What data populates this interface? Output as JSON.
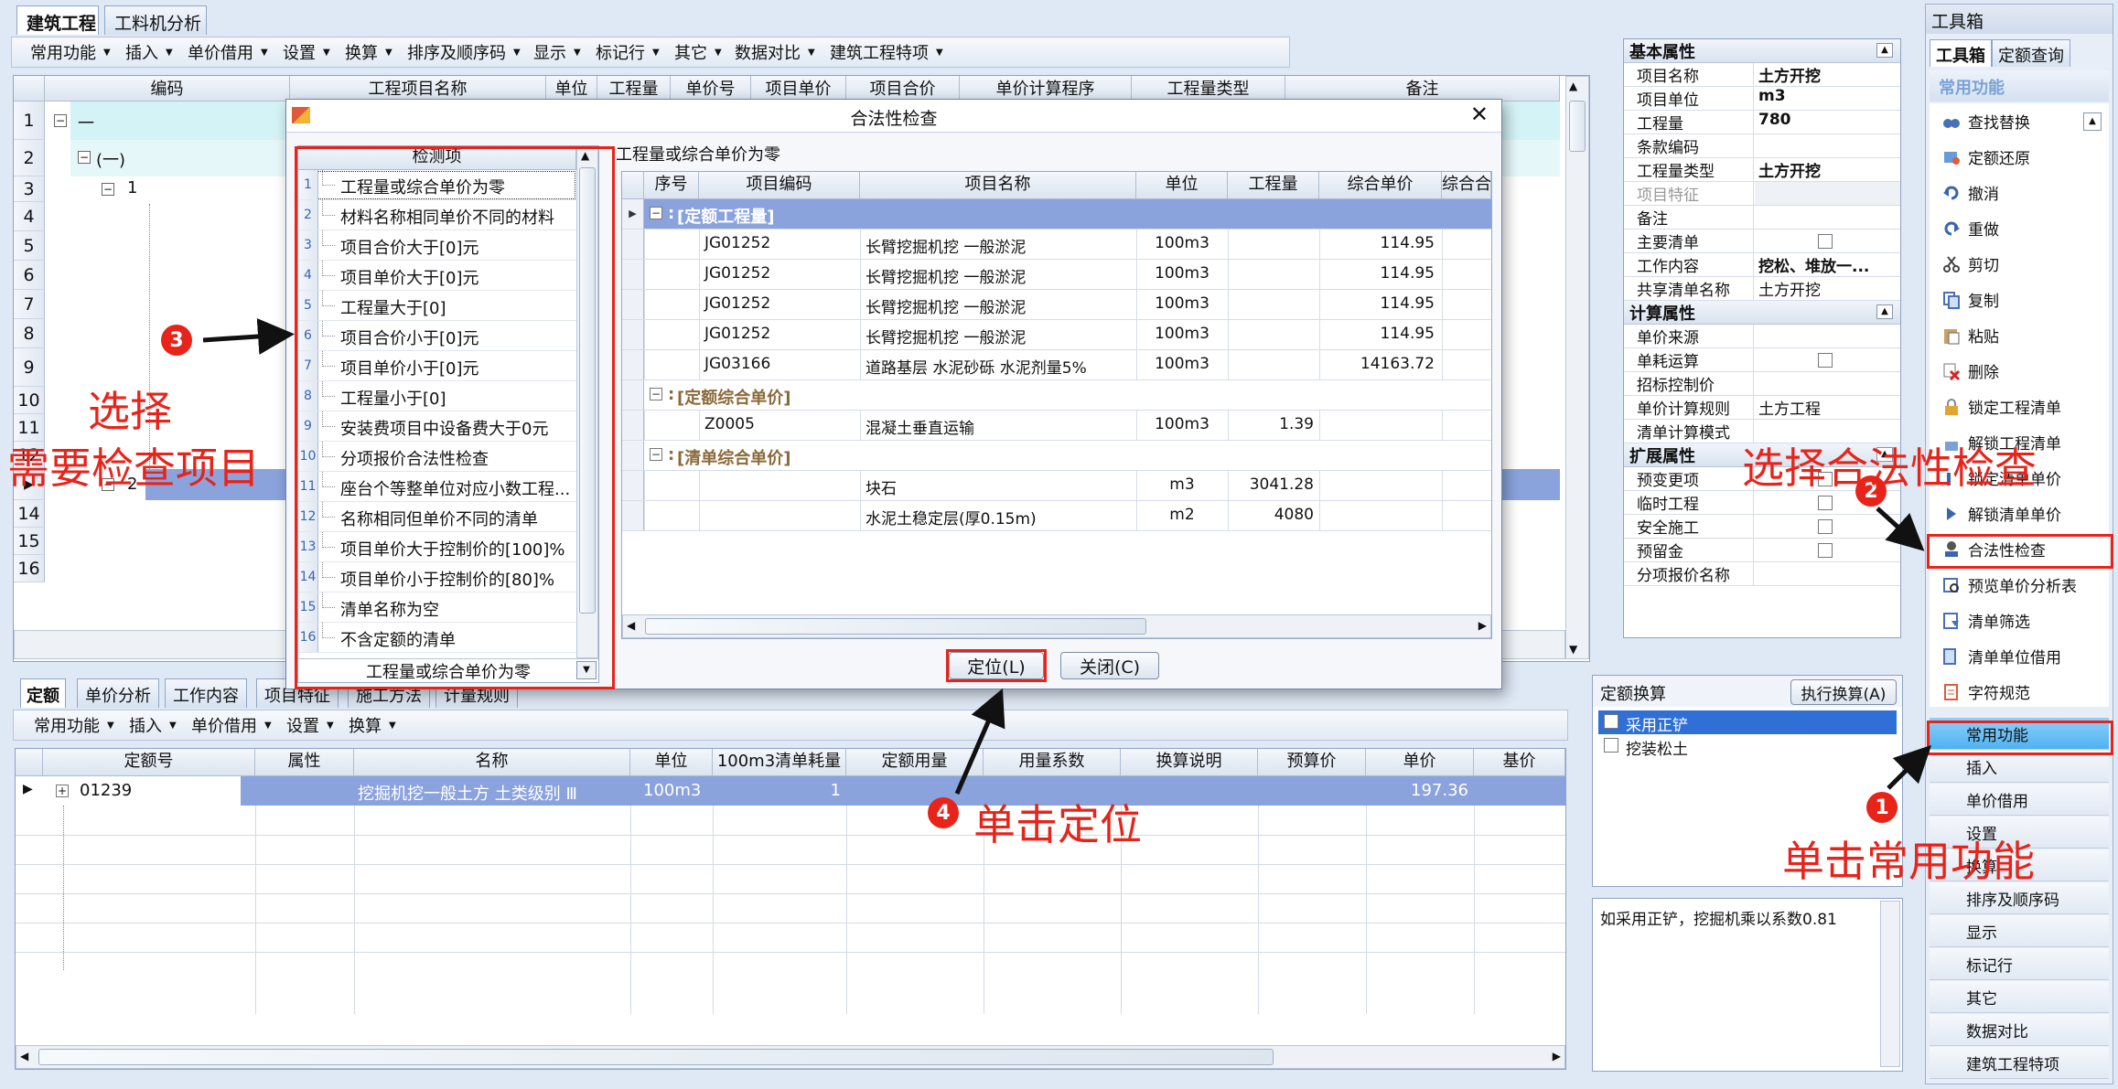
{
  "tabs": [
    "建筑工程",
    "工料机分析"
  ],
  "main_toolbar": [
    "常用功能",
    "插入",
    "单价借用",
    "设置",
    "换算",
    "排序及顺序码",
    "显示",
    "标记行",
    "其它",
    "数据对比",
    "建筑工程特项"
  ],
  "main_grid": {
    "columns": [
      "编码",
      "工程项目名称",
      "单位",
      "工程量",
      "单价号",
      "项目单价",
      "项目合价",
      "单价计算程序",
      "工程量类型",
      "备注"
    ],
    "row_numbers": [
      "1",
      "2",
      "3",
      "4",
      "5",
      "6",
      "7",
      "8",
      "9",
      "10",
      "11",
      "12",
      "",
      "14",
      "15",
      "16"
    ],
    "tree": {
      "r1": "一",
      "r2": "(一)",
      "r3": "1",
      "r12": "2"
    }
  },
  "dialog": {
    "title": "合法性检查",
    "close": "✕",
    "check_header": "检测项",
    "check_items": [
      {
        "n": "1",
        "t": "工程量或综合单价为零"
      },
      {
        "n": "2",
        "t": "材料名称相同单价不同的材料"
      },
      {
        "n": "3",
        "t": "项目合价大于[0]元"
      },
      {
        "n": "4",
        "t": "项目单价大于[0]元"
      },
      {
        "n": "5",
        "t": "工程量大于[0]"
      },
      {
        "n": "6",
        "t": "项目合价小于[0]元"
      },
      {
        "n": "7",
        "t": "项目单价小于[0]元"
      },
      {
        "n": "8",
        "t": "工程量小于[0]"
      },
      {
        "n": "9",
        "t": "安装费项目中设备费大于0元"
      },
      {
        "n": "10",
        "t": "分项报价合法性检查"
      },
      {
        "n": "11",
        "t": "座台个等整单位对应小数工程..."
      },
      {
        "n": "12",
        "t": "名称相同但单价不同的清单"
      },
      {
        "n": "13",
        "t": "项目单价大于控制价的[100]%"
      },
      {
        "n": "14",
        "t": "项目单价小于控制价的[80]%"
      },
      {
        "n": "15",
        "t": "清单名称为空"
      },
      {
        "n": "16",
        "t": "不含定额的清单"
      }
    ],
    "footer_select": "工程量或综合单价为零",
    "result_title": "工程量或综合单价为零",
    "result_columns": [
      "序号",
      "项目编码",
      "项目名称",
      "单位",
      "工程量",
      "综合单价",
      "综合合"
    ],
    "groups": [
      {
        "label": "[定额工程量]",
        "rows": [
          {
            "code": "JG01252",
            "name": "长臂挖掘机挖 一般淤泥",
            "unit": "100m3",
            "qty": "",
            "price": "114.95"
          },
          {
            "code": "JG01252",
            "name": "长臂挖掘机挖 一般淤泥",
            "unit": "100m3",
            "qty": "",
            "price": "114.95"
          },
          {
            "code": "JG01252",
            "name": "长臂挖掘机挖 一般淤泥",
            "unit": "100m3",
            "qty": "",
            "price": "114.95"
          },
          {
            "code": "JG01252",
            "name": "长臂挖掘机挖 一般淤泥",
            "unit": "100m3",
            "qty": "",
            "price": "114.95"
          },
          {
            "code": "JG03166",
            "name": "道路基层 水泥砂砾 水泥剂量5%",
            "unit": "100m3",
            "qty": "",
            "price": "14163.72"
          }
        ]
      },
      {
        "label": "[定额综合单价]",
        "rows": [
          {
            "code": "Z0005",
            "name": "混凝土垂直运输",
            "unit": "100m3",
            "qty": "1.39",
            "price": ""
          }
        ]
      },
      {
        "label": "[清单综合单价]",
        "rows": [
          {
            "code": "",
            "name": "块石",
            "unit": "m3",
            "qty": "3041.28",
            "price": ""
          },
          {
            "code": "",
            "name": "水泥土稳定层(厚0.15m)",
            "unit": "m2",
            "qty": "4080",
            "price": ""
          }
        ]
      }
    ],
    "locate_btn": "定位(L)",
    "close_btn": "关闭(C)"
  },
  "props": {
    "sec_basic": "基本属性",
    "basic": [
      {
        "k": "项目名称",
        "v": "土方开挖"
      },
      {
        "k": "项目单位",
        "v": "m3"
      },
      {
        "k": "工程量",
        "v": "780"
      },
      {
        "k": "条款编码",
        "v": ""
      },
      {
        "k": "工程量类型",
        "v": "土方开挖"
      },
      {
        "k": "项目特征",
        "v": ""
      },
      {
        "k": "备注",
        "v": ""
      },
      {
        "k": "主要清单",
        "v": ""
      },
      {
        "k": "工作内容",
        "v": "挖松、堆放一..."
      },
      {
        "k": "共享清单名称",
        "v": "土方开挖"
      }
    ],
    "sec_calc": "计算属性",
    "calc": [
      {
        "k": "单价来源",
        "v": ""
      },
      {
        "k": "单耗运算",
        "v": ""
      },
      {
        "k": "招标控制价",
        "v": ""
      },
      {
        "k": "单价计算规则",
        "v": "土方工程"
      },
      {
        "k": "清单计算模式",
        "v": ""
      }
    ],
    "sec_ext": "扩展属性",
    "ext": [
      {
        "k": "预变更项",
        "v": ""
      },
      {
        "k": "临时工程",
        "v": ""
      },
      {
        "k": "安全施工",
        "v": ""
      },
      {
        "k": "预留金",
        "v": ""
      },
      {
        "k": "分项报价名称",
        "v": ""
      }
    ]
  },
  "toolbox": {
    "title": "工具箱",
    "tabs": [
      "工具箱",
      "定额查询"
    ],
    "section": "常用功能",
    "items": [
      "查找替换",
      "定额还原",
      "撤消",
      "重做",
      "剪切",
      "复制",
      "粘贴",
      "删除",
      "锁定工程清单",
      "解锁工程清单",
      "锁定清单单价",
      "解锁清单单价",
      "合法性检查",
      "预览单价分析表",
      "清单筛选",
      "清单单位借用",
      "字符规范"
    ],
    "side_buttons": [
      "常用功能",
      "插入",
      "单价借用",
      "设置",
      "换算",
      "排序及顺序码",
      "显示",
      "标记行",
      "其它",
      "数据对比",
      "建筑工程特项"
    ]
  },
  "bottom": {
    "tabs": [
      "定额",
      "单价分析",
      "工作内容",
      "项目特征",
      "施工方法",
      "计量规则"
    ],
    "toolbar": [
      "常用功能",
      "插入",
      "单价借用",
      "设置",
      "换算"
    ],
    "columns": [
      "定额号",
      "属性",
      "名称",
      "单位",
      "100m3清单耗量",
      "定额用量",
      "用量系数",
      "换算说明",
      "预算价",
      "单价",
      "基价"
    ],
    "row": {
      "code": "01239",
      "attr": "",
      "name": "挖掘机挖一般土方 土类级别 Ⅲ",
      "unit": "100m3",
      "usage": "1",
      "price": "197.36"
    }
  },
  "conv": {
    "title": "定额换算",
    "exec": "执行换算(A)",
    "items": [
      "采用正铲",
      "挖装松土"
    ],
    "note": "如采用正铲，挖掘机乘以系数0.81"
  },
  "annotations": {
    "a1": "单击常用功能",
    "a2": "选择合法性检查",
    "a3_line1": "选择",
    "a3_line2": "需要检查项目",
    "a4": "单击定位",
    "n1": "1",
    "n2": "2",
    "n3": "3",
    "n4": "4"
  },
  "colors": {
    "selection": "#8aa3dc",
    "accent_red": "#e8231a",
    "tree_highlight": "#d4f3f6"
  }
}
